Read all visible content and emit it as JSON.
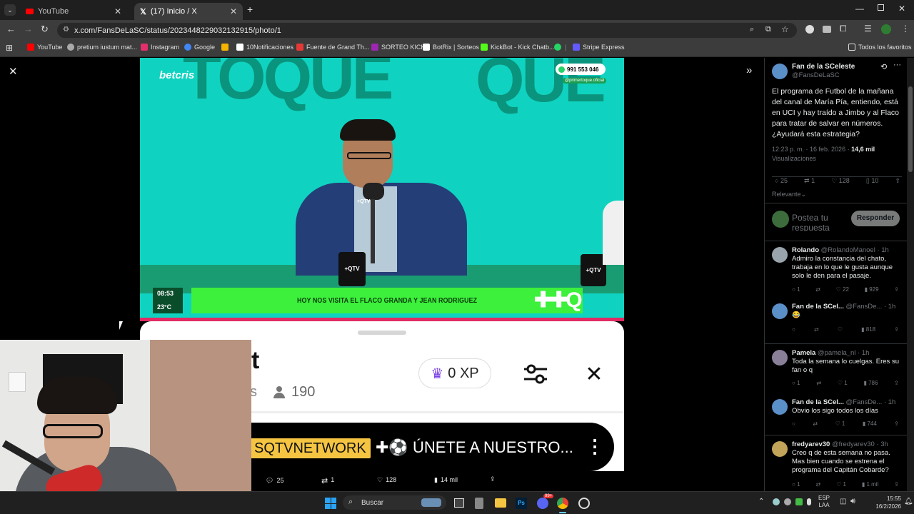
{
  "browser": {
    "tabs": [
      {
        "label": "YouTube",
        "active": false
      },
      {
        "label": "(17) Inicio / X",
        "active": true
      }
    ],
    "url": "x.com/FansDeLaSC/status/2023448229032132915/photo/1",
    "bookmarks": [
      {
        "label": "YouTube",
        "color": "#ff0000"
      },
      {
        "label": "pretium iustum mat...",
        "color": "#aaaaaa"
      },
      {
        "label": "Instagram",
        "color": "#e1306c"
      },
      {
        "label": "Google",
        "color": "#4285f4"
      },
      {
        "label": "",
        "color": "#f4b400"
      },
      {
        "label": "10Notificaciones",
        "color": "#ffffff"
      },
      {
        "label": "Fuente de Grand Th...",
        "color": "#e53935"
      },
      {
        "label": "SORTEO KICK",
        "color": "#9c27b0"
      },
      {
        "label": "BotRix | Sorteos",
        "color": "#ffffff"
      },
      {
        "label": "KickBot - Kick Chatb...",
        "color": "#53fc18"
      },
      {
        "label": "",
        "color": "#25d366"
      },
      {
        "label": "Stripe Express",
        "color": "#635bff"
      }
    ],
    "all_bookmarks": "Todos los favoritos"
  },
  "photo": {
    "brand": "betcris",
    "phone": "991 553 046",
    "handle": "@primertoque.oficial",
    "time": "08:53",
    "temp": "23°C",
    "ticker": "HOY NOS VISITA EL FLACO GRANDA Y JEAN RODRIGUEZ",
    "mic_label": "+QTV",
    "big_text_left": "TOQUE",
    "big_text_right": "QUE"
  },
  "overlay": {
    "partial_title": "t",
    "partial_sub": "s",
    "viewers": "190",
    "xp": "0 XP",
    "banner_tag": "SQTVNETWORK",
    "banner_text": "ÚNETE A NUESTRO..."
  },
  "bottom_actions": {
    "replies": "25",
    "reposts": "1",
    "likes": "128",
    "views": "14 mil"
  },
  "post": {
    "author": "Fan de la SCeleste",
    "handle": "@FansDeLaSC",
    "text": "El programa de Futbol de la mañana del canal de María Pía, entiendo, está en UCI y hay traído a Jimbo y al Flaco para tratar de salvar en números. ¿Ayudará esta estrategia?",
    "timestamp": "12:23 p. m. · 16 feb. 2026 ·",
    "views_count": "14,6 mil",
    "views_label": "Visualizaciones",
    "stats": {
      "replies": "25",
      "reposts": "1",
      "likes": "128",
      "bookmarks": "10"
    },
    "sort_label": "Relevante",
    "reply_placeholder": "Postea tu respuesta",
    "reply_button": "Responder"
  },
  "replies": [
    {
      "name": "Rolando",
      "handle": "@RolandoManoel · 1h",
      "text": "Admiro la constancia del chato, trabaja en lo que le gusta aunque solo le den para el pasaje.",
      "replies": "1",
      "reposts": "",
      "likes": "22",
      "views": "929",
      "avatar": "#9aa4ad"
    },
    {
      "name": "Fan de la SCel...",
      "handle": "@FansDe... · 1h",
      "text": "😂",
      "replies": "",
      "reposts": "",
      "likes": "",
      "views": "818",
      "avatar": "#5b8fc7"
    },
    {
      "name": "Pamela",
      "handle": "@pamela_nl · 1h",
      "text": "Toda la semana lo cuelgas. Eres su fan o q",
      "replies": "1",
      "reposts": "",
      "likes": "1",
      "views": "786",
      "avatar": "#8a7f99"
    },
    {
      "name": "Fan de la SCel...",
      "handle": "@FansDe... · 1h",
      "text": "Obvio los sigo todos los días",
      "replies": "",
      "reposts": "",
      "likes": "1",
      "views": "744",
      "avatar": "#5b8fc7"
    },
    {
      "name": "fredyarev30",
      "handle": "@fredyarev30 · 3h",
      "text": "Creo q de esta semana no pasa. Mas bien cuando se estrena el programa del Capitán Cobarde?",
      "replies": "1",
      "reposts": "",
      "likes": "1",
      "views": "1 mil",
      "avatar": "#c2a35a"
    }
  ],
  "taskbar": {
    "search": "Buscar",
    "lang1": "ESP",
    "lang2": "LAA",
    "time": "15:55",
    "date": "16/2/2026",
    "badge": "99+"
  }
}
